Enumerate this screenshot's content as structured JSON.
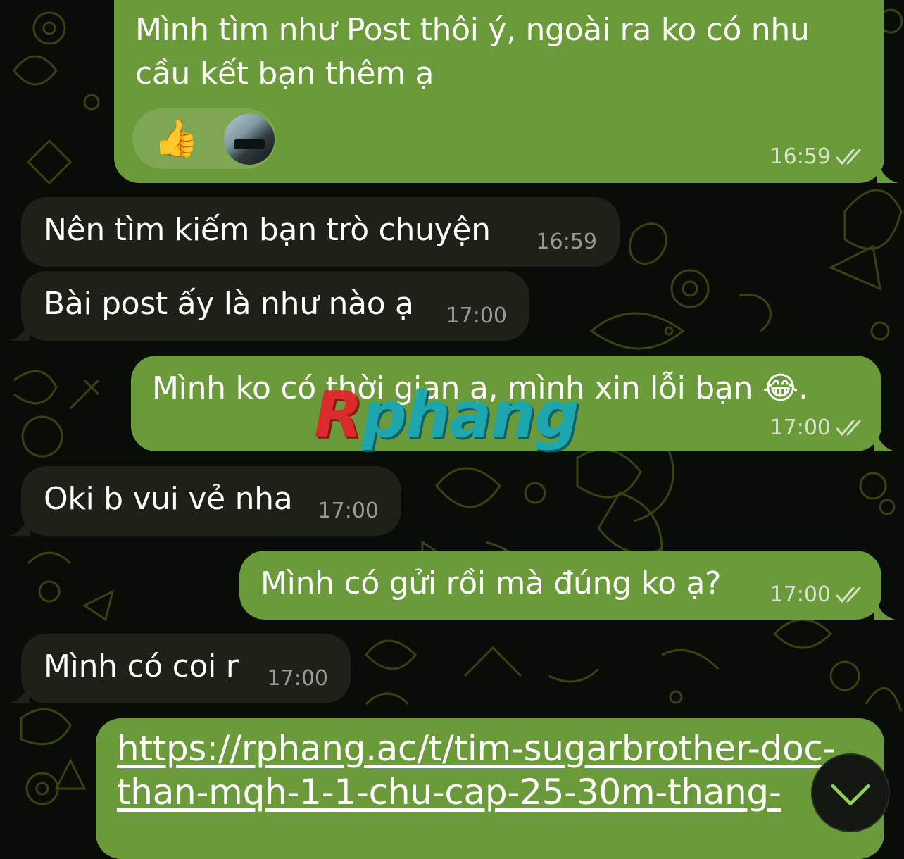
{
  "messages": [
    {
      "direction": "out",
      "text": "Mình tìm như Post thôi ý, ngoài ra ko có nhu cầu kết bạn thêm ạ",
      "time": "16:59",
      "status": "read",
      "reactions": [
        {
          "emoji": "👍",
          "icon": "thumbs-up-icon"
        },
        {
          "icon": "user-avatar"
        }
      ]
    },
    {
      "direction": "in",
      "text": "Nên tìm kiếm bạn trò chuyện",
      "time": "16:59"
    },
    {
      "direction": "in",
      "text": "Bài post ấy là như nào ạ",
      "time": "17:00"
    },
    {
      "direction": "out",
      "text": "Mình ko có thời gian ạ, mình xin lỗi bạn 😂.",
      "time": "17:00",
      "status": "read"
    },
    {
      "direction": "in",
      "text": "Oki b vui vẻ nha",
      "time": "17:00"
    },
    {
      "direction": "out",
      "text": "Mình có gửi rồi mà đúng ko ạ?",
      "time": "17:00",
      "status": "read"
    },
    {
      "direction": "in",
      "text": "Mình có coi r",
      "time": "17:00"
    },
    {
      "direction": "out",
      "link": [
        "https://rphang.ac/t/tim-sugarbrother-doc-",
        "than-mqh-1-1-chu-cap-25-30m-thang-"
      ]
    }
  ],
  "watermark": {
    "r": "R",
    "rest": "phang"
  },
  "scroll_button": {
    "icon": "chevron-down-icon"
  },
  "colors": {
    "outgoing_bubble": "#6b9a3a",
    "incoming_bubble": "#1e2117",
    "background": "#0a0c07",
    "wallpaper_doodle": "#3f4a12"
  }
}
